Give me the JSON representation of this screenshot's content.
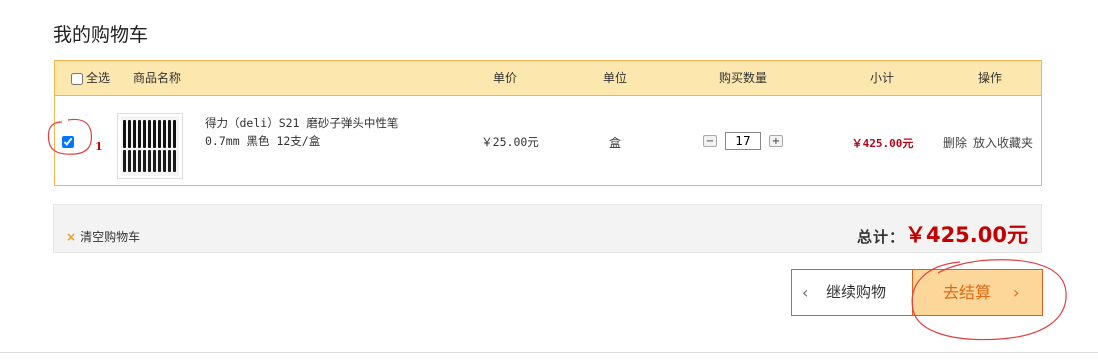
{
  "page_title": "我的购物车",
  "table_headers": {
    "select_all": "全选",
    "name": "商品名称",
    "price": "单价",
    "unit": "单位",
    "quantity": "购买数量",
    "subtotal": "小计",
    "action": "操作"
  },
  "items": [
    {
      "index": "1",
      "checked": true,
      "name_line1": "得力（deli）S21 磨砂子弹头中性笔",
      "name_line2": "0.7mm 黑色 12支/盒",
      "price": "￥25.00元",
      "unit": "盒",
      "quantity": "17",
      "subtotal": "￥425.00元",
      "action_delete": "删除",
      "action_favorite": "放入收藏夹"
    }
  ],
  "qty_minus": "−",
  "qty_plus": "+",
  "clear_cart_icon": "×",
  "clear_cart": "清空购物车",
  "total_label": "总计：",
  "total_value": "￥425.00元",
  "buttons": {
    "continue_shopping": "继续购物",
    "checkout": "去结算",
    "chevron_left": "‹",
    "chevron_right": "›"
  },
  "colors": {
    "header_bg": "#fce7ae",
    "border": "#f2b54f",
    "price_red": "#c40000",
    "checkout_bg": "#fdd69a",
    "annotation_red": "#e04040"
  }
}
